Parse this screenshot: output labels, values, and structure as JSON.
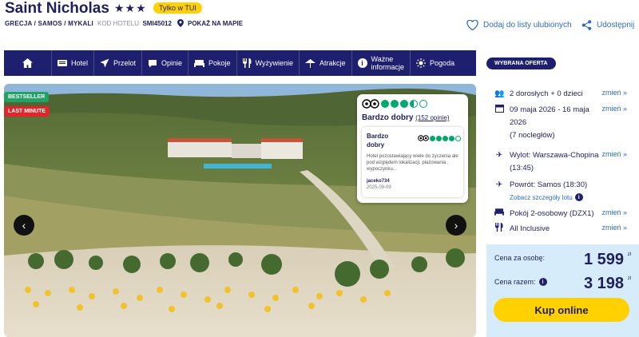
{
  "hotel": {
    "name": "Saint Nicholas",
    "stars": "★★★",
    "badge": "Tylko w TUI",
    "breadcrumb": "GRECJA / SAMOS / MYKALI",
    "code_label": "KOD HOTELU",
    "code_value": "SMI45012",
    "map_link": "POKAŻ NA MAPIE"
  },
  "actions": {
    "favorite": "Dodaj do listy ulubionych",
    "share": "Udostępnij"
  },
  "nav": {
    "items": [
      {
        "label": "Hotel",
        "icon": "hotel-icon"
      },
      {
        "label": "Przelot",
        "icon": "plane-icon"
      },
      {
        "label": "Opinie",
        "icon": "comment-icon"
      },
      {
        "label": "Pokoje",
        "icon": "bed-icon"
      },
      {
        "label": "Wyżywienie",
        "icon": "cutlery-icon"
      },
      {
        "label": "Atrakcje",
        "icon": "attractions-icon"
      },
      {
        "label_line1": "Ważne",
        "label_line2": "informacje",
        "icon": "info-icon"
      },
      {
        "label": "Pogoda",
        "icon": "sun-icon"
      }
    ]
  },
  "gallery": {
    "badge_bestseller": "BESTSELLER",
    "badge_lastminute": "LAST MINUTE"
  },
  "review": {
    "score_dots": 3.5,
    "title": "Bardzo dobry",
    "count": "(152 opinie)",
    "card": {
      "rating_label": "Bardzo dobry",
      "rating_dots": 4,
      "text": "Hotel pozostawiający wiele do życzenia ale pod względem lokalizacji, plażowania , wypoczynku...",
      "author": "jaceko734",
      "date": "2025-09-09"
    }
  },
  "offer": {
    "header": "WYBRANA OFERTA",
    "change": "zmień »",
    "guests": "2 dorosłych + 0 dzieci",
    "dates_line1": "09 maja 2026 - 16 maja",
    "dates_line2": "2026",
    "nights": "(7 nocległów)",
    "departure_line1": "Wylot: Warszawa-Chopina",
    "departure_line2": "(13:45)",
    "return": "Powrót: Samos (18:30)",
    "flight_details": "Zobacz szczegóły lotu",
    "room": "Pokój 2-osobowy (DZX1)",
    "board": "All Inclusive",
    "price_per_person_label": "Cena za osobę:",
    "price_per_person": "1 599",
    "price_total_label": "Cena razem:",
    "price_total": "3 198",
    "currency": "zł",
    "buy_button": "Kup online"
  },
  "colors": {
    "navy": "#1f1f6f",
    "yellow": "#ffd100",
    "link": "#2d6cc0",
    "price_bg": "#d6ecfb",
    "ta_green": "#00aa6c"
  }
}
